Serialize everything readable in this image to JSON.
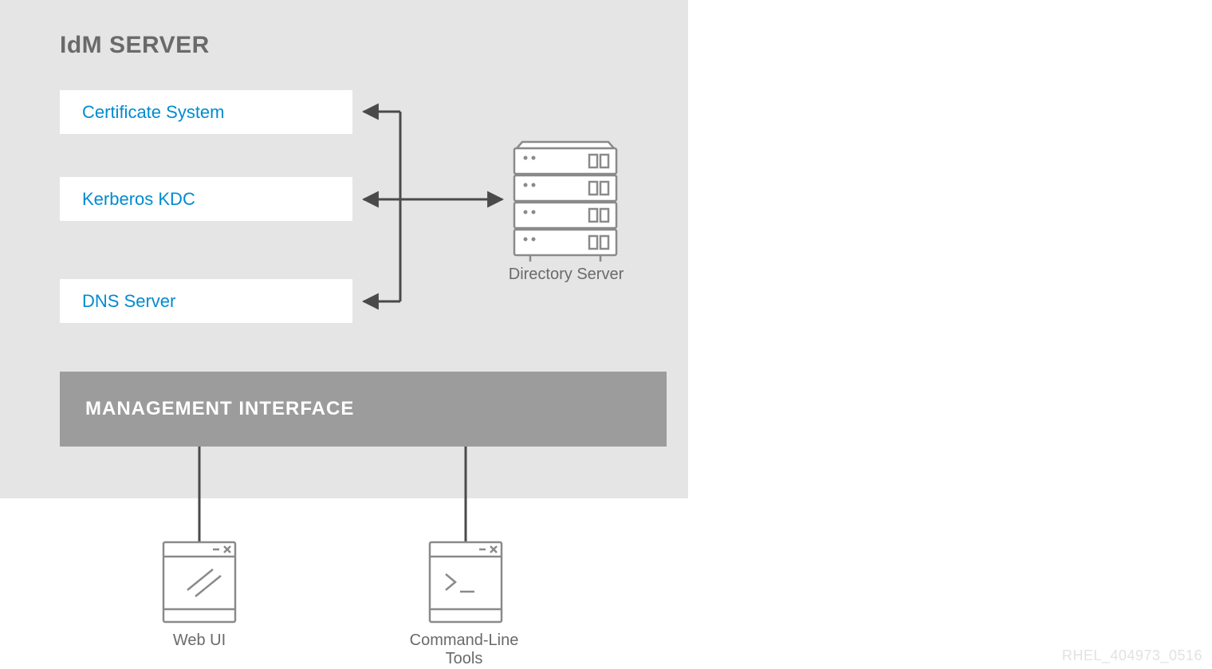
{
  "server": {
    "title": "IdM SERVER",
    "services": {
      "cert": "Certificate System",
      "kdc": "Kerberos KDC",
      "dns": "DNS Server"
    },
    "directory_label": "Directory Server",
    "management_label": "MANAGEMENT INTERFACE"
  },
  "clients": {
    "webui": "Web UI",
    "cli": "Command-Line Tools"
  },
  "footer_id": "RHEL_404973_0516"
}
